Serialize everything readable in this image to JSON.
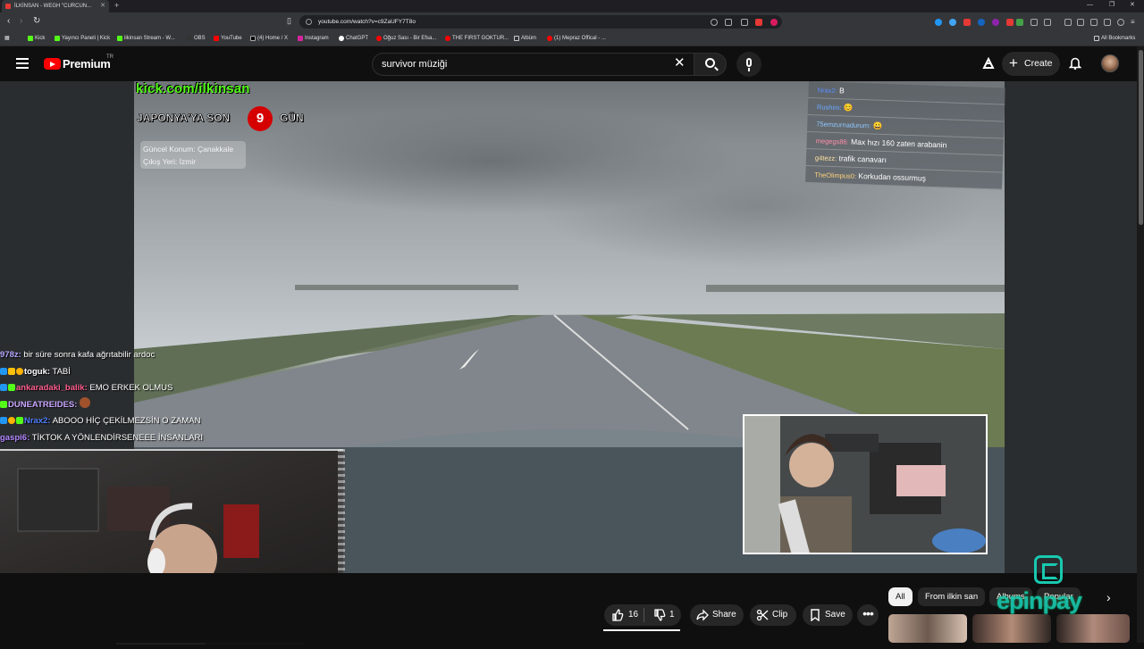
{
  "browser": {
    "tab_title": "İLKİNSAN - WEGH \"CURCUN...",
    "url": "youtube.com/watch?v=c9ZaUFY7T8o",
    "bookmarks": [
      "Kick",
      "Yayıncı Paneli | Kick",
      "ilkinsan Stream - W...",
      "OBS",
      "YouTube",
      "(4) Home / X",
      "Instagram",
      "ChatGPT",
      "Oğuz Sası - Bir Efsa...",
      "THE FIRST GOKTUR...",
      "Albüm",
      "(1) Mepraz Offical - ..."
    ],
    "all_bookmarks": "All Bookmarks"
  },
  "youtube": {
    "brand": "Premium",
    "region": "TR",
    "search_value": "survivor müziği",
    "create_label": "Create"
  },
  "stream_overlay": {
    "kick_url": "kick.com/ilkinsan",
    "countdown_prefix": "JAPONYA'YA SON",
    "countdown_days": "9",
    "countdown_suffix": "GÜN",
    "location_line1": "Güncel Konum: Çanakkale",
    "location_line2": "Çıkış Yeri: İzmir"
  },
  "right_chat": [
    {
      "user": "Nrax2:",
      "msg": "B"
    },
    {
      "user": "Rushim:",
      "msg": "😊"
    },
    {
      "user": "75emzurnadurum:",
      "msg": "😀"
    },
    {
      "user": "megegs86:",
      "msg": "Max hızı 160 zaten arabanin"
    },
    {
      "user": "g4tezz:",
      "msg": "trafik canavarı"
    },
    {
      "user": "TheOlimpus0:",
      "msg": "Korkudan ossurmuş"
    }
  ],
  "left_chat": [
    {
      "user": "978z:",
      "msg": "bir süre sonra kafa ağrıtabilir ardoc",
      "color": "#b7a8ff"
    },
    {
      "user": "toguk:",
      "msg": "TABİ",
      "color": "#ffffff"
    },
    {
      "user": "ankaradaki_balik:",
      "msg": "EMO ERKEK OLMUS",
      "color": "#ff5d8f"
    },
    {
      "user": "DUNEATREIDES:",
      "msg": "",
      "color": "#c9a7ff"
    },
    {
      "user": "Nrax2:",
      "msg": "ABOOO HİÇ ÇEKİLMEZSİN O ZAMAN",
      "color": "#4f7dff"
    },
    {
      "user": "gaspi6:",
      "msg": "TİKTOK A YÖNLENDİRSENEEE İNSANLARI",
      "color": "#b388ff"
    }
  ],
  "actions": {
    "likes": "16",
    "dislikes": "1",
    "share": "Share",
    "clip": "Clip",
    "save": "Save"
  },
  "chips": [
    "All",
    "From ilkin san",
    "Albums",
    "Popular"
  ],
  "sponsor": "epinpay",
  "colors": {
    "kick_green": "#53fc18",
    "yt_red": "#ff0000",
    "epinpay_teal": "#18c9b0"
  }
}
